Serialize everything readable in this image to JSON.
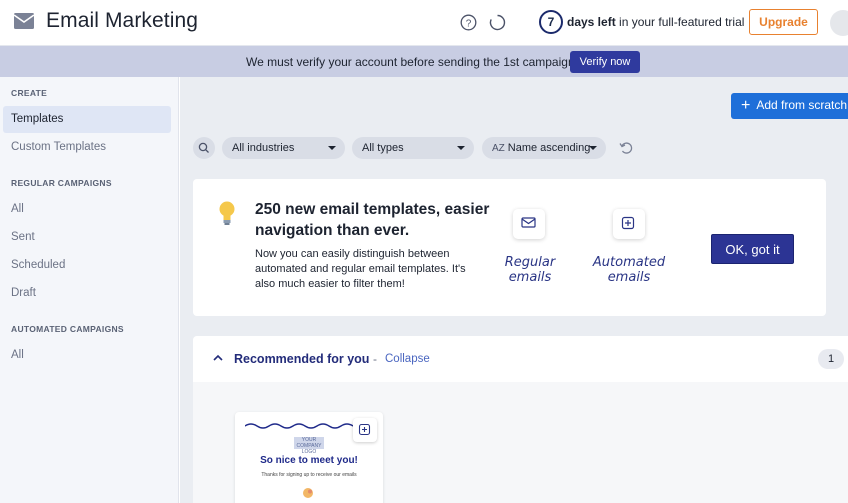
{
  "header": {
    "app_title": "Email Marketing",
    "trial_days": "7",
    "trial_bold": "days left",
    "trial_rest": " in your full-featured trial",
    "upgrade_label": "Upgrade",
    "icons": [
      "email-icon",
      "help-icon",
      "loading-icon",
      "avatar"
    ]
  },
  "banner": {
    "message": "We must verify your account before sending the 1st campaign.",
    "verify_label": "Verify now"
  },
  "sidebar": {
    "sections": [
      {
        "title": "CREATE",
        "items": [
          {
            "label": "Templates",
            "active": true
          },
          {
            "label": "Custom Templates"
          }
        ]
      },
      {
        "title": "REGULAR CAMPAIGNS",
        "items": [
          {
            "label": "All"
          },
          {
            "label": "Sent"
          },
          {
            "label": "Scheduled"
          },
          {
            "label": "Draft"
          }
        ]
      },
      {
        "title": "AUTOMATED CAMPAIGNS",
        "items": [
          {
            "label": "All"
          }
        ]
      }
    ]
  },
  "toolbar": {
    "add_label": "Add from scratch",
    "filters": [
      {
        "value": "All industries"
      },
      {
        "value": "All types"
      },
      {
        "value": "Name ascending",
        "icon": "AZ"
      }
    ]
  },
  "announcement": {
    "title": "250 new email templates, easier navigation than ever.",
    "body": "Now you can easily distinguish between automated and regular email templates. It's also much easier to filter them!",
    "regular_label_1": "Regular",
    "regular_label_2": "emails",
    "automated_label_1": "Automated",
    "automated_label_2": "emails",
    "ok_label": "OK, got it"
  },
  "recommended": {
    "title": "Recommended for you",
    "separator": "-",
    "collapse_label": "Collapse",
    "count": "1",
    "card": {
      "logo_text": "YOUR COMPANY LOGO",
      "heading": "So nice to meet you!",
      "subtext": "Thanks for signing up to receive our emails"
    }
  },
  "colors": {
    "accent_blue": "#1e6fd9",
    "navy": "#2c3494",
    "upgrade_orange": "#e8812f",
    "banner_bg": "#c8cde3"
  }
}
